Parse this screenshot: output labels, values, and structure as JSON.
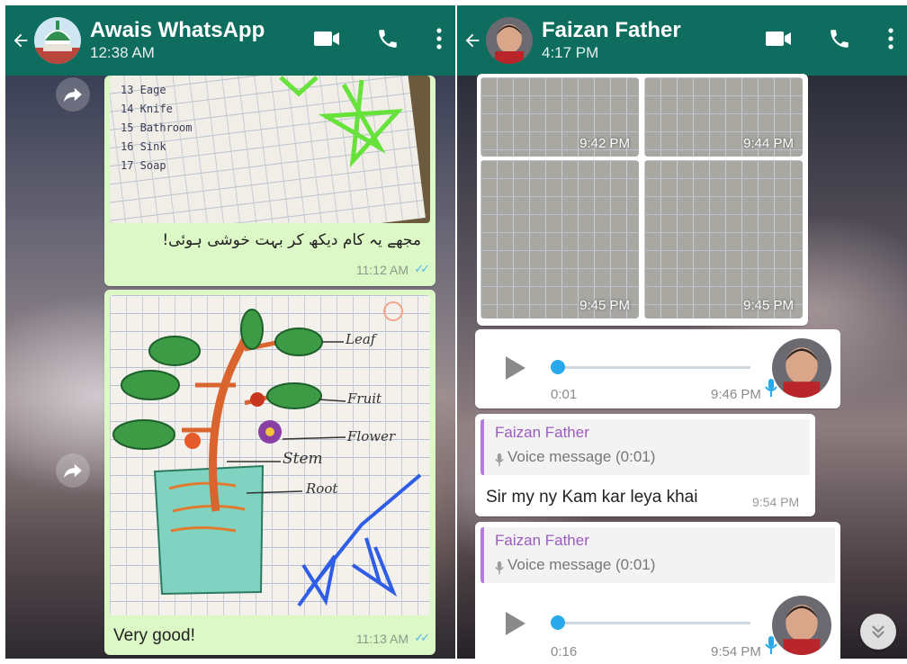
{
  "left_chat": {
    "title": "Awais WhatsApp",
    "subtitle": "12:38 AM",
    "msg1": {
      "caption": "مجھے یہ کام دیکھ کر بہت خوشی ہوئی!",
      "time": "11:12 AM"
    },
    "msg2": {
      "caption": "Very good!",
      "time": "11:13 AM",
      "drawing_labels": [
        "Leaf",
        "Fruit",
        "Flower",
        "Stem",
        "Root"
      ]
    },
    "vocab": [
      "13 Eage",
      "14 Knife",
      "15 Bathroom",
      "16 Sink",
      "17 Soap"
    ]
  },
  "right_chat": {
    "title": "Faizan Father",
    "subtitle": "4:17 PM",
    "image_times": [
      "9:42 PM",
      "9:44 PM",
      "9:45 PM",
      "9:45 PM"
    ],
    "voice1": {
      "duration": "0:01",
      "time": "9:46 PM"
    },
    "reply1": {
      "quoted_name": "Faizan Father",
      "quoted_text": "Voice message (0:01)",
      "text": "Sir my ny Kam kar leya khai",
      "time": "9:54 PM"
    },
    "reply2": {
      "quoted_name": "Faizan Father",
      "quoted_text": "Voice message (0:01)"
    },
    "voice2": {
      "duration": "0:16",
      "time": "9:54 PM"
    }
  },
  "colors": {
    "header": "#0f6d5f",
    "outgoing_bubble": "#dcf8c6",
    "read_ticks": "#4fb6ec",
    "voice_dot": "#29a8ec",
    "quote_accent": "#b57bd9"
  },
  "icons": [
    "back-arrow-icon",
    "video-call-icon",
    "phone-icon",
    "more-vert-icon",
    "forward-icon",
    "play-icon",
    "mic-icon",
    "double-chevron-down-icon"
  ]
}
